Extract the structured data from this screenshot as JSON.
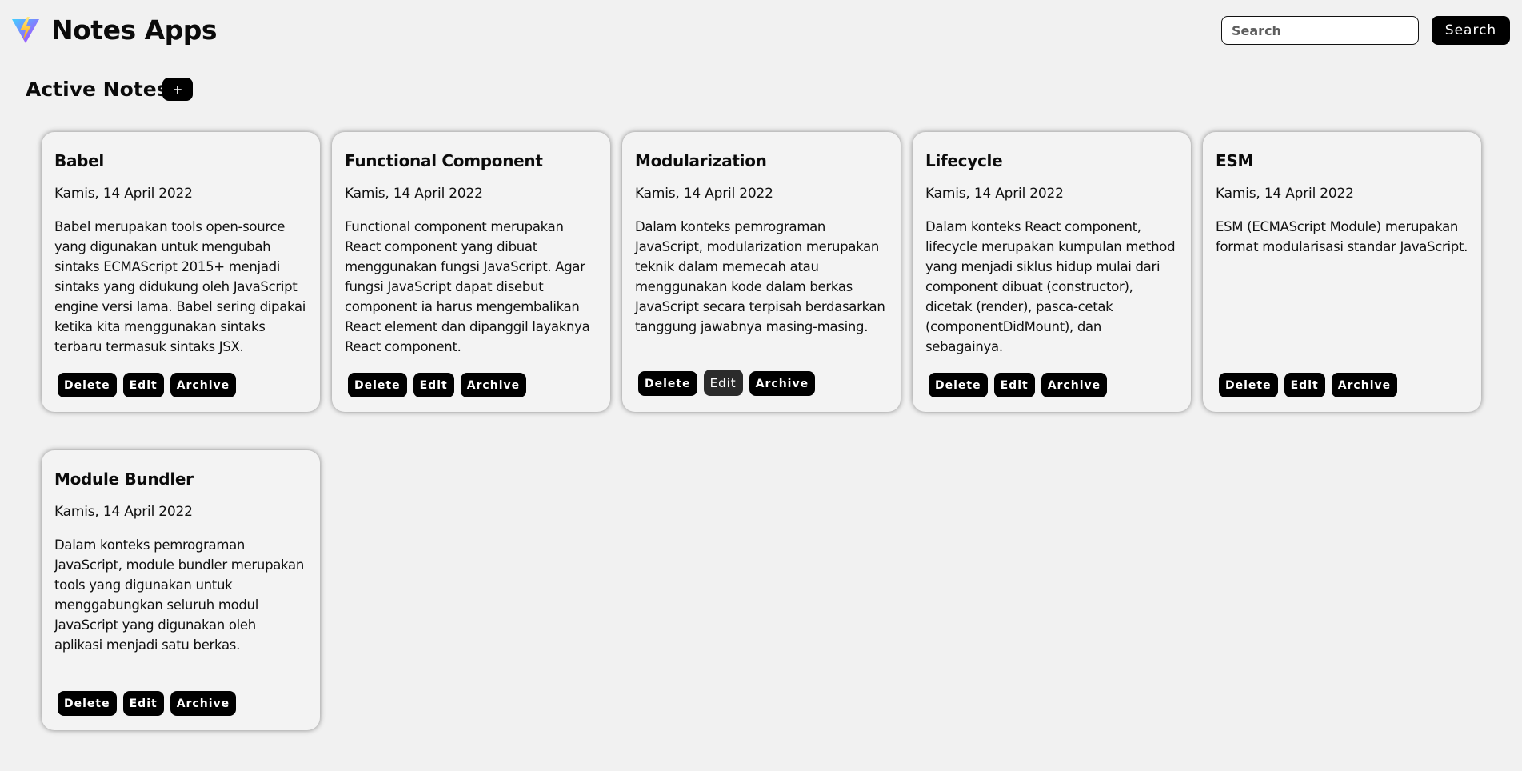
{
  "header": {
    "app_title": "Notes Apps",
    "search_placeholder": "Search",
    "search_button_label": "Search"
  },
  "section": {
    "title": "Active Notes",
    "add_button_label": "+"
  },
  "notes": [
    {
      "title": "Babel",
      "date": "Kamis, 14 April 2022",
      "body": "Babel merupakan tools open-source yang digunakan untuk mengubah sintaks ECMAScript 2015+ menjadi sintaks yang didukung oleh JavaScript engine versi lama. Babel sering dipakai ketika kita menggunakan sintaks terbaru termasuk sintaks JSX.",
      "delete_label": "Delete",
      "edit_label": "Edit",
      "archive_label": "Archive"
    },
    {
      "title": "Functional Component",
      "date": "Kamis, 14 April 2022",
      "body": "Functional component merupakan React component yang dibuat menggunakan fungsi JavaScript. Agar fungsi JavaScript dapat disebut component ia harus mengembalikan React element dan dipanggil layaknya React component.",
      "delete_label": "Delete",
      "edit_label": "Edit",
      "archive_label": "Archive"
    },
    {
      "title": "Modularization",
      "date": "Kamis, 14 April 2022",
      "body": "Dalam konteks pemrograman JavaScript, modularization merupakan teknik dalam memecah atau menggunakan kode dalam berkas JavaScript secara terpisah berdasarkan tanggung jawabnya masing-masing.",
      "delete_label": "Delete",
      "edit_label": "Edit",
      "archive_label": "Archive"
    },
    {
      "title": "Lifecycle",
      "date": "Kamis, 14 April 2022",
      "body": "Dalam konteks React component, lifecycle merupakan kumpulan method yang menjadi siklus hidup mulai dari component dibuat (constructor), dicetak (render), pasca-cetak (componentDidMount), dan sebagainya.",
      "delete_label": "Delete",
      "edit_label": "Edit",
      "archive_label": "Archive"
    },
    {
      "title": "ESM",
      "date": "Kamis, 14 April 2022",
      "body": "ESM (ECMAScript Module) merupakan format modularisasi standar JavaScript.",
      "delete_label": "Delete",
      "edit_label": "Edit",
      "archive_label": "Archive"
    },
    {
      "title": "Module Bundler",
      "date": "Kamis, 14 April 2022",
      "body": "Dalam konteks pemrograman JavaScript, module bundler merupakan tools yang digunakan untuk menggabungkan seluruh modul JavaScript yang digunakan oleh aplikasi menjadi satu berkas.",
      "delete_label": "Delete",
      "edit_label": "Edit",
      "archive_label": "Archive"
    }
  ],
  "colors": {
    "background": "#f1f1f1",
    "button": "#000000",
    "button_hover": "#2b2b2b",
    "logo_yellow": "#ffc517",
    "logo_purple": "#9b5cff"
  },
  "icons": {
    "logo": "vite-logo-icon"
  }
}
